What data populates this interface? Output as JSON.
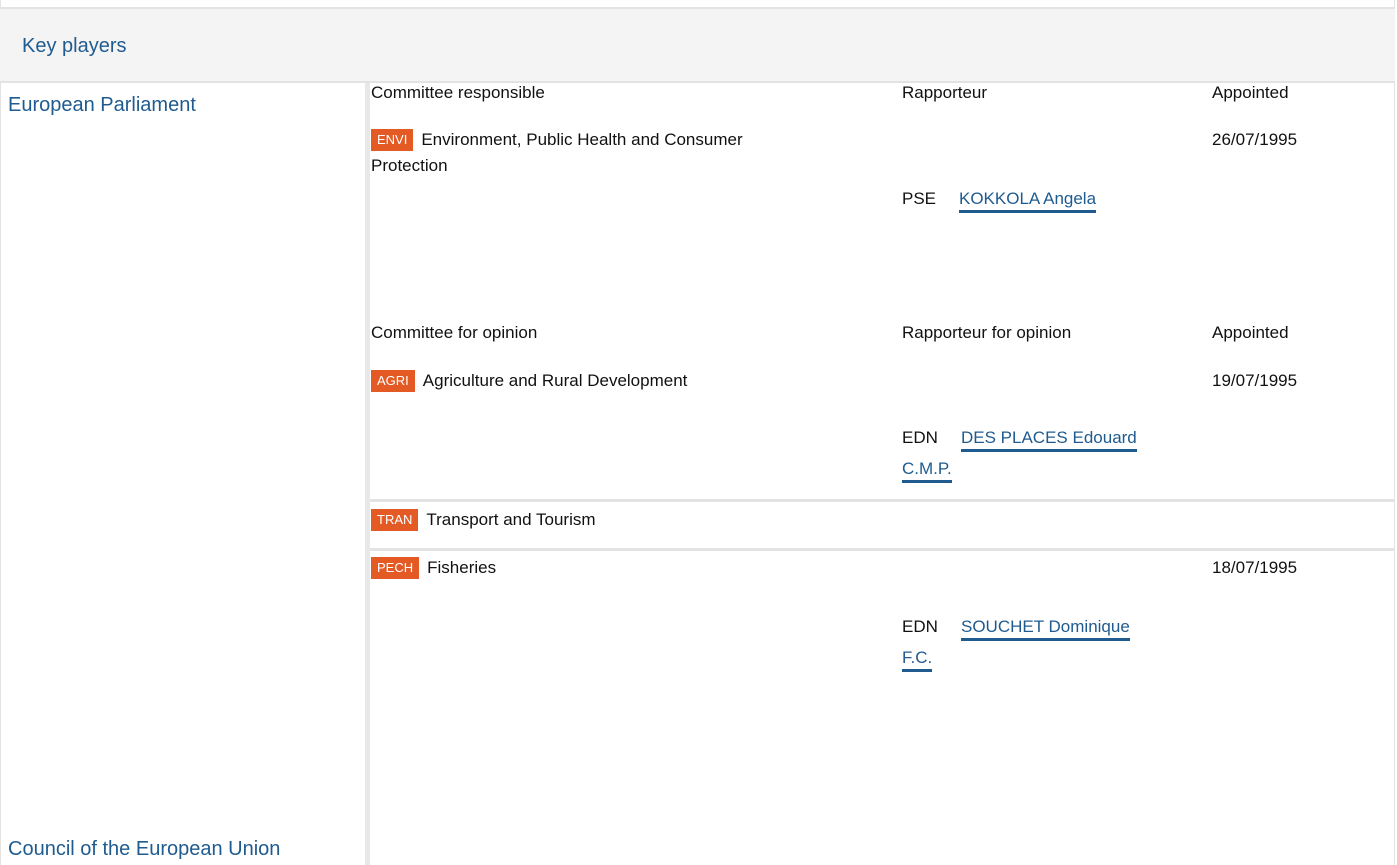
{
  "header": {
    "title": "Key players"
  },
  "sides": {
    "parliament": "European Parliament",
    "council": "Council of the European Union"
  },
  "responsible": {
    "col_committee": "Committee responsible",
    "col_rapporteur": "Rapporteur",
    "col_appointed": "Appointed",
    "committee_code": "ENVI",
    "committee_name_line1": "Environment, Public Health and Consumer",
    "committee_name_line2": "Protection",
    "appointed": "26/07/1995",
    "party": "PSE",
    "rapporteur": "KOKKOLA Angela"
  },
  "opinion": {
    "col_committee": "Committee for opinion",
    "col_rapporteur": "Rapporteur for opinion",
    "col_appointed": "Appointed",
    "rows": [
      {
        "code": "AGRI",
        "name": "Agriculture and Rural Development",
        "appointed": "19/07/1995",
        "party": "EDN",
        "rapporteur_line1": "DES PLACES Edouard",
        "rapporteur_line2": "C.M.P."
      },
      {
        "code": "TRAN",
        "name": "Transport and Tourism"
      },
      {
        "code": "PECH",
        "name": "Fisheries",
        "appointed": "18/07/1995",
        "party": "EDN",
        "rapporteur_line1": "SOUCHET Dominique",
        "rapporteur_line2": "F.C."
      }
    ]
  },
  "colors": {
    "accent": "#1f5b8f",
    "tag": "#e35a24"
  }
}
